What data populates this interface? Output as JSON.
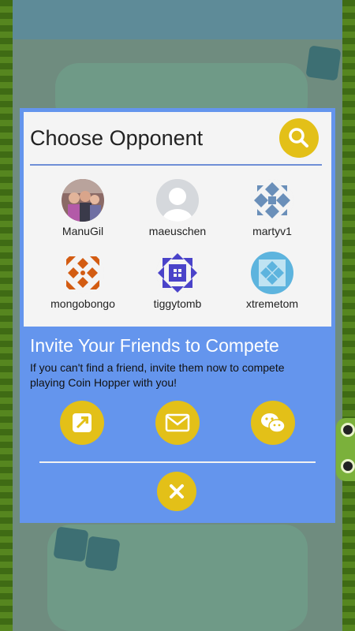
{
  "dialog": {
    "title": "Choose Opponent",
    "search_icon": "search-icon"
  },
  "opponents": [
    {
      "name": "ManuGil",
      "avatar": "photo-avatar"
    },
    {
      "name": "maeuschen",
      "avatar": "default-person-avatar"
    },
    {
      "name": "martyv1",
      "avatar": "geometric-avatar",
      "color": "#6a8fb9"
    },
    {
      "name": "mongobongo",
      "avatar": "geometric-avatar",
      "color": "#d35c12"
    },
    {
      "name": "tiggytomb",
      "avatar": "geometric-avatar",
      "color": "#4a43c9"
    },
    {
      "name": "xtremetom",
      "avatar": "geometric-avatar",
      "color": "#5db4de"
    }
  ],
  "invite": {
    "title": "Invite Your Friends to Compete",
    "text": "If you can't find a friend, invite them now to compete playing Coin Hopper with you!",
    "buttons": [
      {
        "icon": "share-icon"
      },
      {
        "icon": "email-icon"
      },
      {
        "icon": "wechat-icon"
      }
    ]
  },
  "close_icon": "close-icon",
  "colors": {
    "panel_blue": "#6495ed",
    "accent_yellow": "#e3c018"
  }
}
